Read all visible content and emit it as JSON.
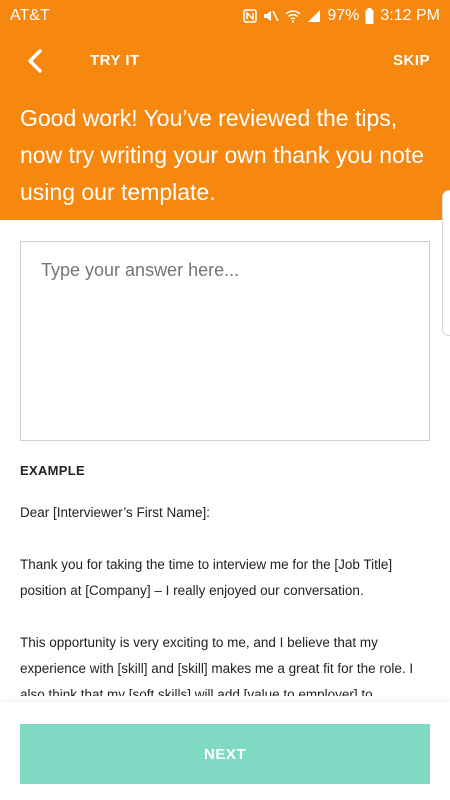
{
  "status_bar": {
    "carrier": "AT&T",
    "battery": "97%",
    "time": "3:12 PM",
    "icons": [
      "nfc-icon",
      "mute-icon",
      "wifi-icon",
      "signal-icon",
      "battery-icon"
    ]
  },
  "header": {
    "title": "TRY IT",
    "skip_label": "SKIP",
    "intro": "Good work! You’ve reviewed the tips, now try writing your own thank you note using our template."
  },
  "answer": {
    "placeholder": "Type your answer here...",
    "value": ""
  },
  "example": {
    "label": "EXAMPLE",
    "greeting": "Dear [Interviewer’s First Name]:",
    "paragraph1": "Thank you for taking the time to interview me for the [Job Title] position at [Company] – I really enjoyed our conversation.",
    "paragraph2": "This opportunity is very exciting to me, and I believe that my experience with [skill] and [skill] makes me a great fit for the role. I also think that my [soft skills] will add [value to employer] to"
  },
  "footer": {
    "next_label": "NEXT"
  },
  "colors": {
    "header_bg": "#f6870f",
    "next_button": "#7fd9c3"
  }
}
